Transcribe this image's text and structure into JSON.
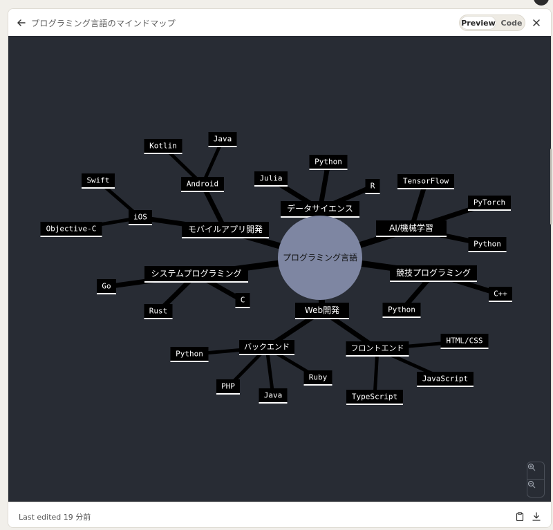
{
  "header": {
    "title": "プログラミング言語のマインドマップ",
    "preview_label": "Preview",
    "code_label": "Code"
  },
  "footer": {
    "last_edited": "Last edited 19 分前"
  },
  "icons": {
    "back": "arrow-left-icon",
    "close": "close-icon",
    "zoom_in": "zoom-in-icon",
    "zoom_out": "zoom-out-icon",
    "copy": "clipboard-icon",
    "download": "download-icon"
  },
  "colors": {
    "canvas_bg": "#282c34",
    "node_bg": "#000000",
    "node_text": "#ffffff",
    "center_fill": "#7e86a2",
    "edge": "#000000"
  },
  "mindmap": {
    "center": "プログラミング言語",
    "branches": [
      {
        "label": "データサイエンス",
        "children": [
          "Julia",
          "Python",
          "R"
        ]
      },
      {
        "label": "AI/機械学習",
        "children": [
          "TensorFlow",
          "PyTorch",
          "Python"
        ]
      },
      {
        "label": "競技プログラミング",
        "children": [
          "Python",
          "C++"
        ]
      },
      {
        "label": "Web開発",
        "children": [
          {
            "label": "バックエンド",
            "children": [
              "Python",
              "PHP",
              "Java",
              "Ruby"
            ]
          },
          {
            "label": "フロントエンド",
            "children": [
              "TypeScript",
              "JavaScript",
              "HTML/CSS"
            ]
          }
        ]
      },
      {
        "label": "システムプログラミング",
        "children": [
          "Go",
          "Rust",
          "C"
        ]
      },
      {
        "label": "モバイルアプリ開発",
        "children": [
          {
            "label": "iOS",
            "children": [
              "Swift",
              "Objective-C"
            ]
          },
          {
            "label": "Android",
            "children": [
              "Kotlin",
              "Java"
            ]
          }
        ]
      }
    ]
  }
}
